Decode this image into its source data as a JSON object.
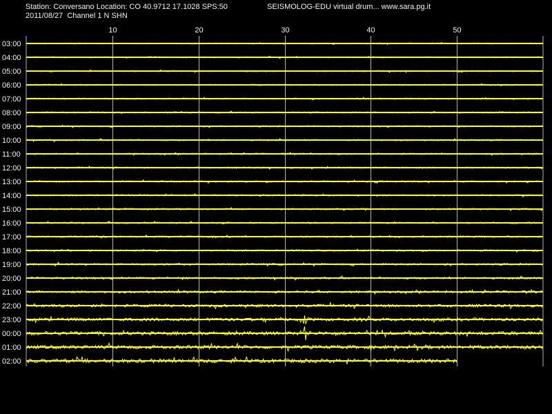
{
  "header": {
    "station_line": "Station: Conversano Location: CO 40.9712 17.1028 SPS:50",
    "app_line": "SEISMOLOG-EDU virtual drum... www.sara.pg.it",
    "date_channel_line": "2011/08/27  Channel 1 N SHN"
  },
  "colors": {
    "background": "#000000",
    "grid": "#b4b4b4",
    "trace": "#ffff00",
    "text": "#f2f2f2"
  },
  "chart_data": {
    "type": "line",
    "title": "",
    "xlabel": "",
    "ylabel": "",
    "xlim": [
      0,
      60
    ],
    "x_ticks": [
      10,
      20,
      30,
      40,
      50
    ],
    "grid": true,
    "rows": [
      {
        "label": "03:00",
        "amp": 0.8,
        "end": 60
      },
      {
        "label": "04:00",
        "amp": 0.8,
        "end": 60
      },
      {
        "label": "05:00",
        "amp": 0.9,
        "end": 60
      },
      {
        "label": "06:00",
        "amp": 0.9,
        "end": 60
      },
      {
        "label": "07:00",
        "amp": 0.9,
        "end": 60
      },
      {
        "label": "08:00",
        "amp": 1.0,
        "end": 60
      },
      {
        "label": "09:00",
        "amp": 1.0,
        "end": 60
      },
      {
        "label": "10:00",
        "amp": 1.0,
        "end": 60
      },
      {
        "label": "11:00",
        "amp": 1.0,
        "end": 60
      },
      {
        "label": "12:00",
        "amp": 1.0,
        "end": 60
      },
      {
        "label": "13:00",
        "amp": 1.1,
        "end": 60
      },
      {
        "label": "14:00",
        "amp": 1.1,
        "end": 60
      },
      {
        "label": "15:00",
        "amp": 1.1,
        "end": 60
      },
      {
        "label": "16:00",
        "amp": 1.1,
        "end": 60
      },
      {
        "label": "17:00",
        "amp": 1.2,
        "end": 60
      },
      {
        "label": "18:00",
        "amp": 1.2,
        "end": 60
      },
      {
        "label": "19:00",
        "amp": 1.3,
        "end": 60
      },
      {
        "label": "20:00",
        "amp": 1.4,
        "end": 60
      },
      {
        "label": "21:00",
        "amp": 1.6,
        "end": 60
      },
      {
        "label": "22:00",
        "amp": 2.0,
        "end": 60
      },
      {
        "label": "23:00",
        "amp": 2.2,
        "end": 60,
        "spike_at": 32.3,
        "spike_amp": 6
      },
      {
        "label": "00:00",
        "amp": 2.5,
        "end": 60,
        "spike_at": 32.4,
        "spike_amp": 10
      },
      {
        "label": "01:00",
        "amp": 2.6,
        "end": 60
      },
      {
        "label": "02:00",
        "amp": 2.8,
        "end": 50
      }
    ]
  }
}
